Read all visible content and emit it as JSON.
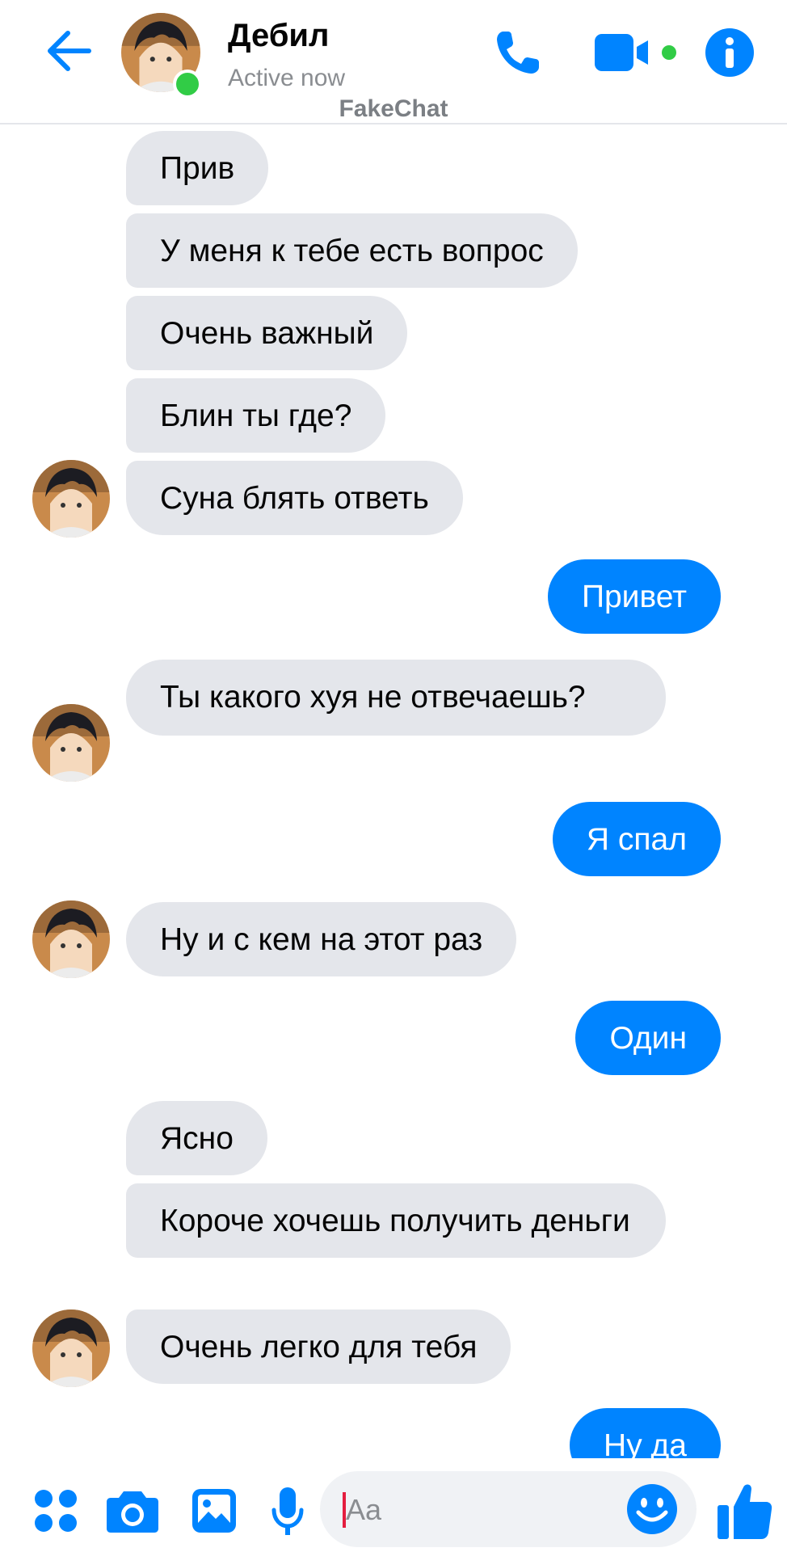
{
  "header": {
    "contact_name": "Дебил",
    "status": "Active now",
    "watermark": "FakeChat",
    "icons": [
      "back-arrow-icon",
      "phone-icon",
      "video-camera-icon",
      "info-icon"
    ],
    "presence_color": "#31cc46"
  },
  "messages": [
    {
      "from": "contact",
      "text": "Прив"
    },
    {
      "from": "contact",
      "text": "У меня к тебе есть вопрос"
    },
    {
      "from": "contact",
      "text": "Очень важный"
    },
    {
      "from": "contact",
      "text": "Блин ты где?"
    },
    {
      "from": "contact",
      "text": "Суна блять ответь"
    },
    {
      "from": "me",
      "text": "Привет"
    },
    {
      "from": "contact",
      "text": "Ты какого хуя не отвечаешь?"
    },
    {
      "from": "me",
      "text": "Я спал"
    },
    {
      "from": "contact",
      "text": "Ну и с кем на этот раз"
    },
    {
      "from": "me",
      "text": "Один"
    },
    {
      "from": "contact",
      "text": "Ясно"
    },
    {
      "from": "contact",
      "text": "Короче хочешь получить деньги"
    },
    {
      "from": "contact",
      "text": "Очень легко для тебя"
    },
    {
      "from": "me",
      "text": "Ну да"
    }
  ],
  "composer": {
    "placeholder": "Aa",
    "icons": [
      "apps-icon",
      "camera-icon",
      "gallery-icon",
      "microphone-icon",
      "emoji-icon",
      "thumbs-up-icon"
    ]
  },
  "colors": {
    "accent": "#0084ff",
    "incoming_bubble": "#e4e6eb",
    "outgoing_text": "#ffffff"
  }
}
